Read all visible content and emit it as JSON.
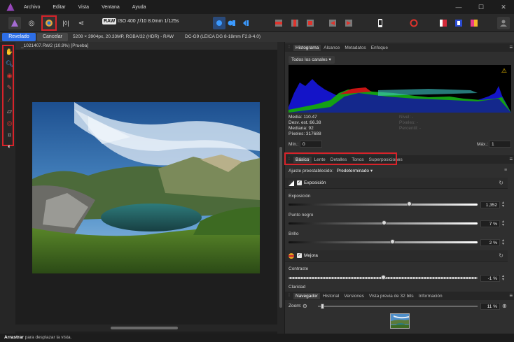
{
  "menu": [
    "Archivo",
    "Editar",
    "Vista",
    "Ventana",
    "Ayuda"
  ],
  "toolbar": {
    "raw_badge": "RAW",
    "exif": "ISO 400 ƒ/10 8.0mm 1/125s",
    "icons": [
      "develop-persona-icon",
      "liquify-persona-icon",
      "develop-icon",
      "tone-mapping-icon",
      "export-icon",
      "share-icon",
      "assistant-icon",
      "clipping-icon",
      "before-after-icon",
      "split-view-icon"
    ]
  },
  "contextbar": {
    "develop_button": "Revelado",
    "cancel_button": "Cancelar",
    "image_info": "5208 × 3904px, 20.33MP, RGBA/32 (HDR) - RAW",
    "camera_info": "DC-G9 (LEICA DG 8-18mm F2.8-4.0)"
  },
  "document": {
    "tab_title": "_1021407.RW2 (10.9%) [Prueba]"
  },
  "right_panel": {
    "top_tabs": [
      "Histograma",
      "Alcance",
      "Metadatos",
      "Enfoque"
    ],
    "histogram": {
      "channel_select": "Todos los canales",
      "stats": [
        "Media: 110.47",
        "Desv. est.:66.38",
        "Mediana: 92",
        "Píxeles: 317688"
      ],
      "stats_dim": [
        "Nivel: -",
        "Píxeles: -",
        "Percentil: -"
      ],
      "min_label": "Mín.:",
      "min_value": "0",
      "max_label": "Máx.:",
      "max_value": "1"
    },
    "develop_tabs": [
      "Básico",
      "Lente",
      "Detalles",
      "Tonos",
      "Superposiciones"
    ],
    "preset_label": "Ajuste preestablecido:",
    "preset_value": "Predeterminado",
    "exposure_section": {
      "title": "Exposición",
      "sliders": [
        {
          "label": "Exposición",
          "value": "1,352"
        },
        {
          "label": "Punto negro",
          "value": "7 %"
        },
        {
          "label": "Brillo",
          "value": "2 %"
        }
      ]
    },
    "enhance_section": {
      "title": "Mejora",
      "sliders": [
        {
          "label": "Contraste",
          "value": "-1 %"
        },
        {
          "label": "Claridad",
          "value": ""
        }
      ]
    },
    "bottom_tabs": [
      "Navegador",
      "Historial",
      "Versiones",
      "Vista previa de 32 bits",
      "Información"
    ],
    "navigator": {
      "zoom_label": "Zoom:",
      "zoom_value": "11 %"
    }
  },
  "status": {
    "bold": "Arrastrar",
    "text": " para desplazar la vista."
  },
  "colors": {
    "accent_blue": "#2d6ee6",
    "highlight_red": "#d8232a"
  }
}
